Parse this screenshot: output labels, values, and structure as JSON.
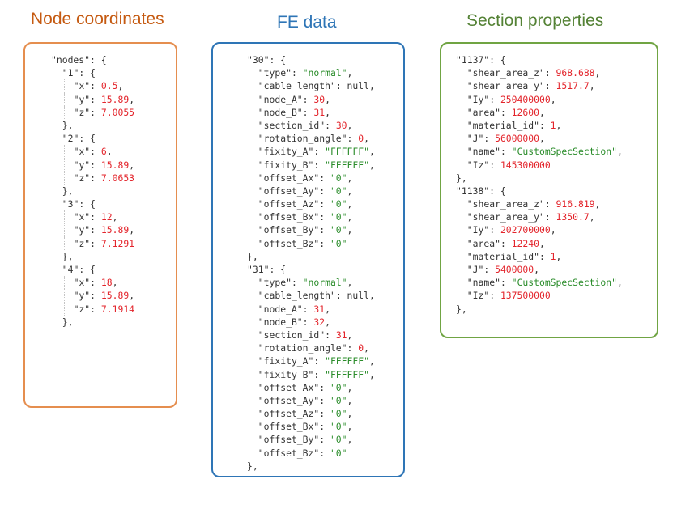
{
  "colors": {
    "node_title": "#c55a11",
    "node_border": "#e58e4f",
    "fe_title": "#2e75b6",
    "fe_border": "#2e75b6",
    "section_title": "#548235",
    "section_border": "#70a443",
    "key": "#333333",
    "number": "#e3242b",
    "string": "#2a8c2a",
    "null": "#555555"
  },
  "titles": {
    "nodes": "Node coordinates",
    "fe": "FE data",
    "sections": "Section properties"
  },
  "node_panel": {
    "lines": [
      [
        0,
        [
          [
            "k",
            "\"nodes\""
          ],
          [
            "p",
            ": {"
          ]
        ]
      ],
      [
        1,
        [
          [
            "k",
            "\"1\""
          ],
          [
            "p",
            ": {"
          ]
        ]
      ],
      [
        2,
        [
          [
            "k",
            "\"x\""
          ],
          [
            "p",
            ": "
          ],
          [
            "n",
            "0.5"
          ],
          [
            "p",
            ","
          ]
        ]
      ],
      [
        2,
        [
          [
            "k",
            "\"y\""
          ],
          [
            "p",
            ": "
          ],
          [
            "n",
            "15.89"
          ],
          [
            "p",
            ","
          ]
        ]
      ],
      [
        2,
        [
          [
            "k",
            "\"z\""
          ],
          [
            "p",
            ": "
          ],
          [
            "n",
            "7.0055"
          ]
        ]
      ],
      [
        1,
        [
          [
            "p",
            "},"
          ]
        ]
      ],
      [
        1,
        [
          [
            "k",
            "\"2\""
          ],
          [
            "p",
            ": {"
          ]
        ]
      ],
      [
        2,
        [
          [
            "k",
            "\"x\""
          ],
          [
            "p",
            ": "
          ],
          [
            "n",
            "6"
          ],
          [
            "p",
            ","
          ]
        ]
      ],
      [
        2,
        [
          [
            "k",
            "\"y\""
          ],
          [
            "p",
            ": "
          ],
          [
            "n",
            "15.89"
          ],
          [
            "p",
            ","
          ]
        ]
      ],
      [
        2,
        [
          [
            "k",
            "\"z\""
          ],
          [
            "p",
            ": "
          ],
          [
            "n",
            "7.0653"
          ]
        ]
      ],
      [
        1,
        [
          [
            "p",
            "},"
          ]
        ]
      ],
      [
        1,
        [
          [
            "k",
            "\"3\""
          ],
          [
            "p",
            ": {"
          ]
        ]
      ],
      [
        2,
        [
          [
            "k",
            "\"x\""
          ],
          [
            "p",
            ": "
          ],
          [
            "n",
            "12"
          ],
          [
            "p",
            ","
          ]
        ]
      ],
      [
        2,
        [
          [
            "k",
            "\"y\""
          ],
          [
            "p",
            ": "
          ],
          [
            "n",
            "15.89"
          ],
          [
            "p",
            ","
          ]
        ]
      ],
      [
        2,
        [
          [
            "k",
            "\"z\""
          ],
          [
            "p",
            ": "
          ],
          [
            "n",
            "7.1291"
          ]
        ]
      ],
      [
        1,
        [
          [
            "p",
            "},"
          ]
        ]
      ],
      [
        1,
        [
          [
            "k",
            "\"4\""
          ],
          [
            "p",
            ": {"
          ]
        ]
      ],
      [
        2,
        [
          [
            "k",
            "\"x\""
          ],
          [
            "p",
            ": "
          ],
          [
            "n",
            "18"
          ],
          [
            "p",
            ","
          ]
        ]
      ],
      [
        2,
        [
          [
            "k",
            "\"y\""
          ],
          [
            "p",
            ": "
          ],
          [
            "n",
            "15.89"
          ],
          [
            "p",
            ","
          ]
        ]
      ],
      [
        2,
        [
          [
            "k",
            "\"z\""
          ],
          [
            "p",
            ": "
          ],
          [
            "n",
            "7.1914"
          ]
        ]
      ],
      [
        1,
        [
          [
            "p",
            "},"
          ]
        ]
      ]
    ]
  },
  "fe_panel": {
    "lines": [
      [
        0,
        [
          [
            "k",
            "\"30\""
          ],
          [
            "p",
            ": {"
          ]
        ]
      ],
      [
        1,
        [
          [
            "k",
            "\"type\""
          ],
          [
            "p",
            ": "
          ],
          [
            "s",
            "\"normal\""
          ],
          [
            "p",
            ","
          ]
        ]
      ],
      [
        1,
        [
          [
            "k",
            "\"cable_length\""
          ],
          [
            "p",
            ": "
          ],
          [
            "k",
            "null"
          ],
          [
            "p",
            ","
          ]
        ]
      ],
      [
        1,
        [
          [
            "k",
            "\"node_A\""
          ],
          [
            "p",
            ": "
          ],
          [
            "n",
            "30"
          ],
          [
            "p",
            ","
          ]
        ]
      ],
      [
        1,
        [
          [
            "k",
            "\"node_B\""
          ],
          [
            "p",
            ": "
          ],
          [
            "n",
            "31"
          ],
          [
            "p",
            ","
          ]
        ]
      ],
      [
        1,
        [
          [
            "k",
            "\"section_id\""
          ],
          [
            "p",
            ": "
          ],
          [
            "n",
            "30"
          ],
          [
            "p",
            ","
          ]
        ]
      ],
      [
        1,
        [
          [
            "k",
            "\"rotation_angle\""
          ],
          [
            "p",
            ": "
          ],
          [
            "n",
            "0"
          ],
          [
            "p",
            ","
          ]
        ]
      ],
      [
        1,
        [
          [
            "k",
            "\"fixity_A\""
          ],
          [
            "p",
            ": "
          ],
          [
            "s",
            "\"FFFFFF\""
          ],
          [
            "p",
            ","
          ]
        ]
      ],
      [
        1,
        [
          [
            "k",
            "\"fixity_B\""
          ],
          [
            "p",
            ": "
          ],
          [
            "s",
            "\"FFFFFF\""
          ],
          [
            "p",
            ","
          ]
        ]
      ],
      [
        1,
        [
          [
            "k",
            "\"offset_Ax\""
          ],
          [
            "p",
            ": "
          ],
          [
            "s",
            "\"0\""
          ],
          [
            "p",
            ","
          ]
        ]
      ],
      [
        1,
        [
          [
            "k",
            "\"offset_Ay\""
          ],
          [
            "p",
            ": "
          ],
          [
            "s",
            "\"0\""
          ],
          [
            "p",
            ","
          ]
        ]
      ],
      [
        1,
        [
          [
            "k",
            "\"offset_Az\""
          ],
          [
            "p",
            ": "
          ],
          [
            "s",
            "\"0\""
          ],
          [
            "p",
            ","
          ]
        ]
      ],
      [
        1,
        [
          [
            "k",
            "\"offset_Bx\""
          ],
          [
            "p",
            ": "
          ],
          [
            "s",
            "\"0\""
          ],
          [
            "p",
            ","
          ]
        ]
      ],
      [
        1,
        [
          [
            "k",
            "\"offset_By\""
          ],
          [
            "p",
            ": "
          ],
          [
            "s",
            "\"0\""
          ],
          [
            "p",
            ","
          ]
        ]
      ],
      [
        1,
        [
          [
            "k",
            "\"offset_Bz\""
          ],
          [
            "p",
            ": "
          ],
          [
            "s",
            "\"0\""
          ]
        ]
      ],
      [
        0,
        [
          [
            "p",
            "},"
          ]
        ]
      ],
      [
        0,
        [
          [
            "k",
            "\"31\""
          ],
          [
            "p",
            ": {"
          ]
        ]
      ],
      [
        1,
        [
          [
            "k",
            "\"type\""
          ],
          [
            "p",
            ": "
          ],
          [
            "s",
            "\"normal\""
          ],
          [
            "p",
            ","
          ]
        ]
      ],
      [
        1,
        [
          [
            "k",
            "\"cable_length\""
          ],
          [
            "p",
            ": "
          ],
          [
            "k",
            "null"
          ],
          [
            "p",
            ","
          ]
        ]
      ],
      [
        1,
        [
          [
            "k",
            "\"node_A\""
          ],
          [
            "p",
            ": "
          ],
          [
            "n",
            "31"
          ],
          [
            "p",
            ","
          ]
        ]
      ],
      [
        1,
        [
          [
            "k",
            "\"node_B\""
          ],
          [
            "p",
            ": "
          ],
          [
            "n",
            "32"
          ],
          [
            "p",
            ","
          ]
        ]
      ],
      [
        1,
        [
          [
            "k",
            "\"section_id\""
          ],
          [
            "p",
            ": "
          ],
          [
            "n",
            "31"
          ],
          [
            "p",
            ","
          ]
        ]
      ],
      [
        1,
        [
          [
            "k",
            "\"rotation_angle\""
          ],
          [
            "p",
            ": "
          ],
          [
            "n",
            "0"
          ],
          [
            "p",
            ","
          ]
        ]
      ],
      [
        1,
        [
          [
            "k",
            "\"fixity_A\""
          ],
          [
            "p",
            ": "
          ],
          [
            "s",
            "\"FFFFFF\""
          ],
          [
            "p",
            ","
          ]
        ]
      ],
      [
        1,
        [
          [
            "k",
            "\"fixity_B\""
          ],
          [
            "p",
            ": "
          ],
          [
            "s",
            "\"FFFFFF\""
          ],
          [
            "p",
            ","
          ]
        ]
      ],
      [
        1,
        [
          [
            "k",
            "\"offset_Ax\""
          ],
          [
            "p",
            ": "
          ],
          [
            "s",
            "\"0\""
          ],
          [
            "p",
            ","
          ]
        ]
      ],
      [
        1,
        [
          [
            "k",
            "\"offset_Ay\""
          ],
          [
            "p",
            ": "
          ],
          [
            "s",
            "\"0\""
          ],
          [
            "p",
            ","
          ]
        ]
      ],
      [
        1,
        [
          [
            "k",
            "\"offset_Az\""
          ],
          [
            "p",
            ": "
          ],
          [
            "s",
            "\"0\""
          ],
          [
            "p",
            ","
          ]
        ]
      ],
      [
        1,
        [
          [
            "k",
            "\"offset_Bx\""
          ],
          [
            "p",
            ": "
          ],
          [
            "s",
            "\"0\""
          ],
          [
            "p",
            ","
          ]
        ]
      ],
      [
        1,
        [
          [
            "k",
            "\"offset_By\""
          ],
          [
            "p",
            ": "
          ],
          [
            "s",
            "\"0\""
          ],
          [
            "p",
            ","
          ]
        ]
      ],
      [
        1,
        [
          [
            "k",
            "\"offset_Bz\""
          ],
          [
            "p",
            ": "
          ],
          [
            "s",
            "\"0\""
          ]
        ]
      ],
      [
        0,
        [
          [
            "p",
            "},"
          ]
        ]
      ]
    ]
  },
  "section_panel": {
    "lines": [
      [
        0,
        [
          [
            "k",
            "\"1137\""
          ],
          [
            "p",
            ": {"
          ]
        ]
      ],
      [
        1,
        [
          [
            "k",
            "\"shear_area_z\""
          ],
          [
            "p",
            ": "
          ],
          [
            "n",
            "968.688"
          ],
          [
            "p",
            ","
          ]
        ]
      ],
      [
        1,
        [
          [
            "k",
            "\"shear_area_y\""
          ],
          [
            "p",
            ": "
          ],
          [
            "n",
            "1517.7"
          ],
          [
            "p",
            ","
          ]
        ]
      ],
      [
        1,
        [
          [
            "k",
            "\"Iy\""
          ],
          [
            "p",
            ": "
          ],
          [
            "n",
            "250400000"
          ],
          [
            "p",
            ","
          ]
        ]
      ],
      [
        1,
        [
          [
            "k",
            "\"area\""
          ],
          [
            "p",
            ": "
          ],
          [
            "n",
            "12600"
          ],
          [
            "p",
            ","
          ]
        ]
      ],
      [
        1,
        [
          [
            "k",
            "\"material_id\""
          ],
          [
            "p",
            ": "
          ],
          [
            "n",
            "1"
          ],
          [
            "p",
            ","
          ]
        ]
      ],
      [
        1,
        [
          [
            "k",
            "\"J\""
          ],
          [
            "p",
            ": "
          ],
          [
            "n",
            "56000000"
          ],
          [
            "p",
            ","
          ]
        ]
      ],
      [
        1,
        [
          [
            "k",
            "\"name\""
          ],
          [
            "p",
            ": "
          ],
          [
            "s",
            "\"CustomSpecSection\""
          ],
          [
            "p",
            ","
          ]
        ]
      ],
      [
        1,
        [
          [
            "k",
            "\"Iz\""
          ],
          [
            "p",
            ": "
          ],
          [
            "n",
            "145300000"
          ]
        ]
      ],
      [
        0,
        [
          [
            "p",
            "},"
          ]
        ]
      ],
      [
        0,
        [
          [
            "k",
            "\"1138\""
          ],
          [
            "p",
            ": {"
          ]
        ]
      ],
      [
        1,
        [
          [
            "k",
            "\"shear_area_z\""
          ],
          [
            "p",
            ": "
          ],
          [
            "n",
            "916.819"
          ],
          [
            "p",
            ","
          ]
        ]
      ],
      [
        1,
        [
          [
            "k",
            "\"shear_area_y\""
          ],
          [
            "p",
            ": "
          ],
          [
            "n",
            "1350.7"
          ],
          [
            "p",
            ","
          ]
        ]
      ],
      [
        1,
        [
          [
            "k",
            "\"Iy\""
          ],
          [
            "p",
            ": "
          ],
          [
            "n",
            "202700000"
          ],
          [
            "p",
            ","
          ]
        ]
      ],
      [
        1,
        [
          [
            "k",
            "\"area\""
          ],
          [
            "p",
            ": "
          ],
          [
            "n",
            "12240"
          ],
          [
            "p",
            ","
          ]
        ]
      ],
      [
        1,
        [
          [
            "k",
            "\"material_id\""
          ],
          [
            "p",
            ": "
          ],
          [
            "n",
            "1"
          ],
          [
            "p",
            ","
          ]
        ]
      ],
      [
        1,
        [
          [
            "k",
            "\"J\""
          ],
          [
            "p",
            ": "
          ],
          [
            "n",
            "5400000"
          ],
          [
            "p",
            ","
          ]
        ]
      ],
      [
        1,
        [
          [
            "k",
            "\"name\""
          ],
          [
            "p",
            ": "
          ],
          [
            "s",
            "\"CustomSpecSection\""
          ],
          [
            "p",
            ","
          ]
        ]
      ],
      [
        1,
        [
          [
            "k",
            "\"Iz\""
          ],
          [
            "p",
            ": "
          ],
          [
            "n",
            "137500000"
          ]
        ]
      ],
      [
        0,
        [
          [
            "p",
            "},"
          ]
        ]
      ]
    ]
  }
}
